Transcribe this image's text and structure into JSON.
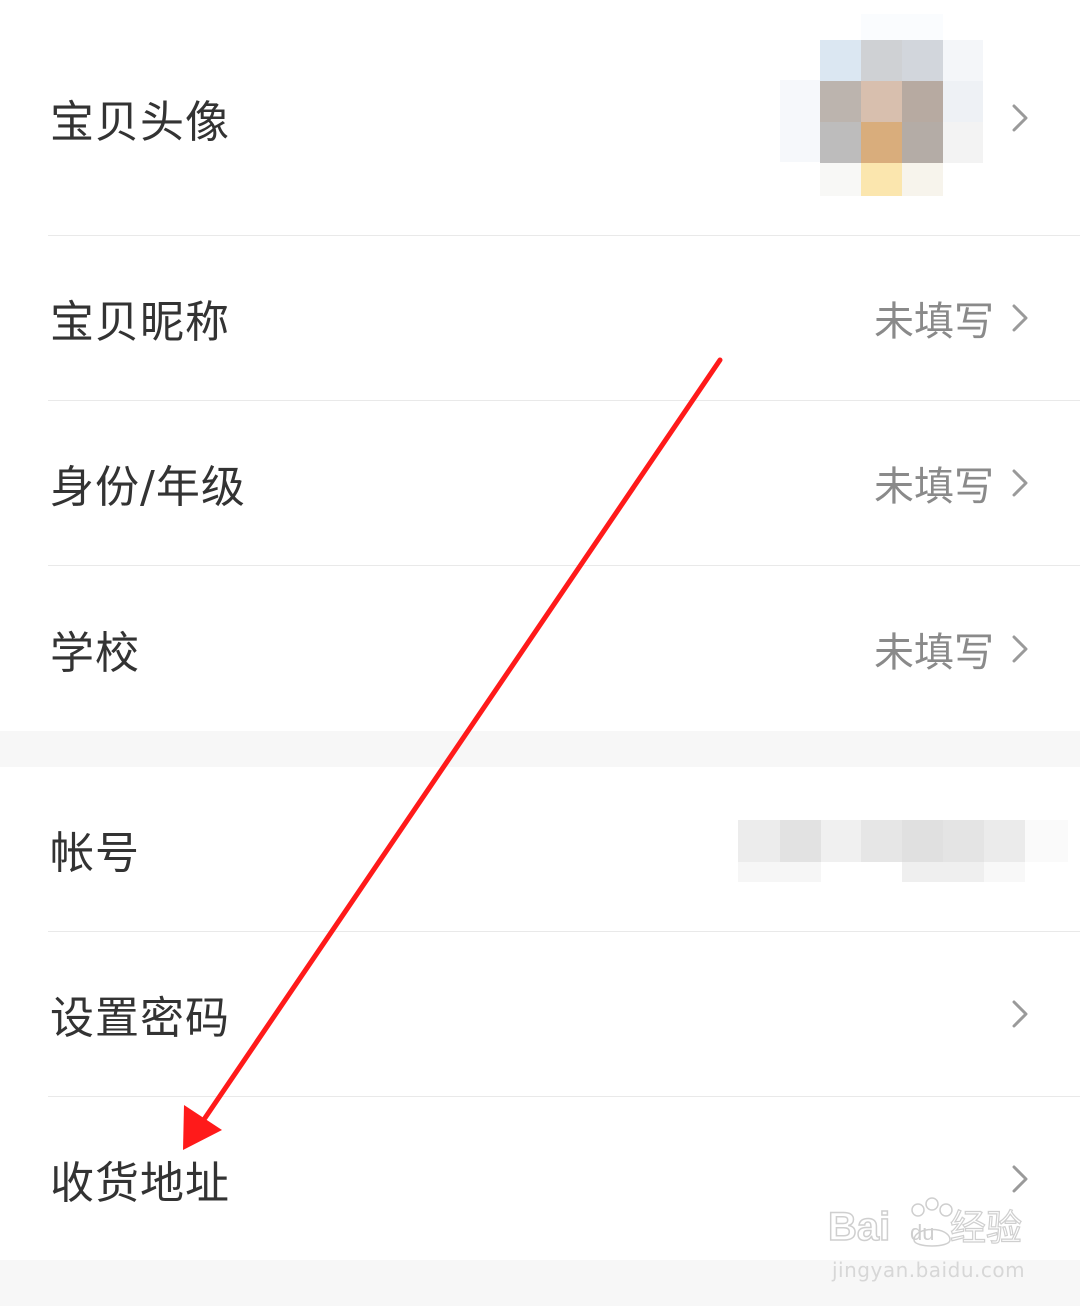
{
  "rows": {
    "avatar": {
      "label": "宝贝头像"
    },
    "nickname": {
      "label": "宝贝昵称",
      "value": "未填写"
    },
    "identity": {
      "label": "身份/年级",
      "value": "未填写"
    },
    "school": {
      "label": "学校",
      "value": "未填写"
    },
    "account": {
      "label": "帐号"
    },
    "password": {
      "label": "设置密码"
    },
    "address": {
      "label": "收货地址"
    }
  },
  "annotation": {
    "arrow_color": "#ff1a1a"
  },
  "watermark": {
    "brand": "Bai",
    "brand2": "du",
    "name": "经验",
    "url": "jingyan.baidu.com"
  },
  "icons": {
    "chevron": "chevron-right-icon"
  }
}
